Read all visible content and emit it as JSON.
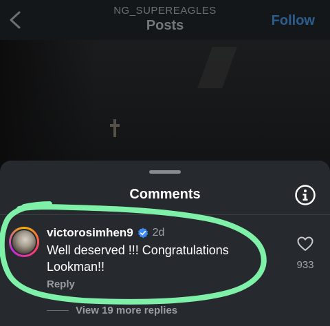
{
  "header": {
    "account_name": "NG_SUPEREAGLES",
    "title": "Posts",
    "follow_label": "Follow",
    "back_icon": "chevron-left-icon"
  },
  "comments_sheet": {
    "title": "Comments",
    "info_icon": "info-icon",
    "comment": {
      "username": "victorosimhen9",
      "verified": true,
      "time": "2d",
      "text": "Well deserved !!! Congratulations Lookman!!",
      "reply_label": "Reply",
      "like_count": "933",
      "view_replies_label": "View 19 more replies"
    }
  },
  "colors": {
    "background": "#111315",
    "sheet": "#26292d",
    "verified": "#3a8af6",
    "highlight": "#7ef0a8",
    "follow": "#2b5e8e"
  }
}
